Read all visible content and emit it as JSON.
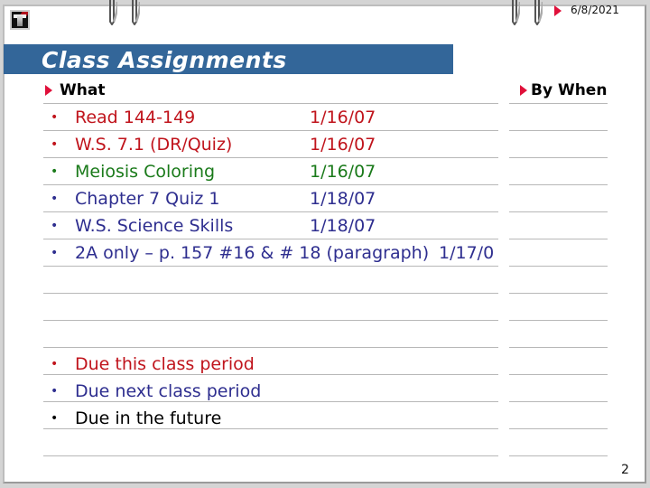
{
  "header": {
    "date": "6/8/2021",
    "logo_icon": "t-logo-icon",
    "clip_icon": "binder-clip-icon"
  },
  "title": "Class Assignments",
  "columns": {
    "what": "What",
    "by_when": "By When"
  },
  "assignments": [
    {
      "what": "Read 144-149",
      "when": "1/16/07",
      "color": "#c0141c",
      "status": "due-this-class"
    },
    {
      "what": "W.S. 7.1 (DR/Quiz)",
      "when": "1/16/07",
      "color": "#c0141c",
      "status": "due-this-class"
    },
    {
      "what": "Meiosis Coloring",
      "when": "1/16/07",
      "color": "#1a7a1a",
      "status": "other"
    },
    {
      "what": "Chapter 7 Quiz 1",
      "when": "1/18/07",
      "color": "#2e2e8f",
      "status": "due-next-class"
    },
    {
      "what": "W.S. Science Skills",
      "when": "1/18/07",
      "color": "#2e2e8f",
      "status": "due-next-class"
    },
    {
      "what": "2A only – p. 157 #16 & # 18 (paragraph)",
      "when": "1/17/0",
      "color": "#2e2e8f",
      "status": "due-next-class"
    }
  ],
  "legend": [
    {
      "label": "Due this class period",
      "color": "#c0141c"
    },
    {
      "label": "Due next class period",
      "color": "#2e2e8f"
    },
    {
      "label": "Due in the future",
      "color": "#000000"
    }
  ],
  "bullet": "•",
  "page_number": "2",
  "colors": {
    "banner": "#336699",
    "marker": "#e0103a",
    "rule": "#b8b8b8"
  }
}
